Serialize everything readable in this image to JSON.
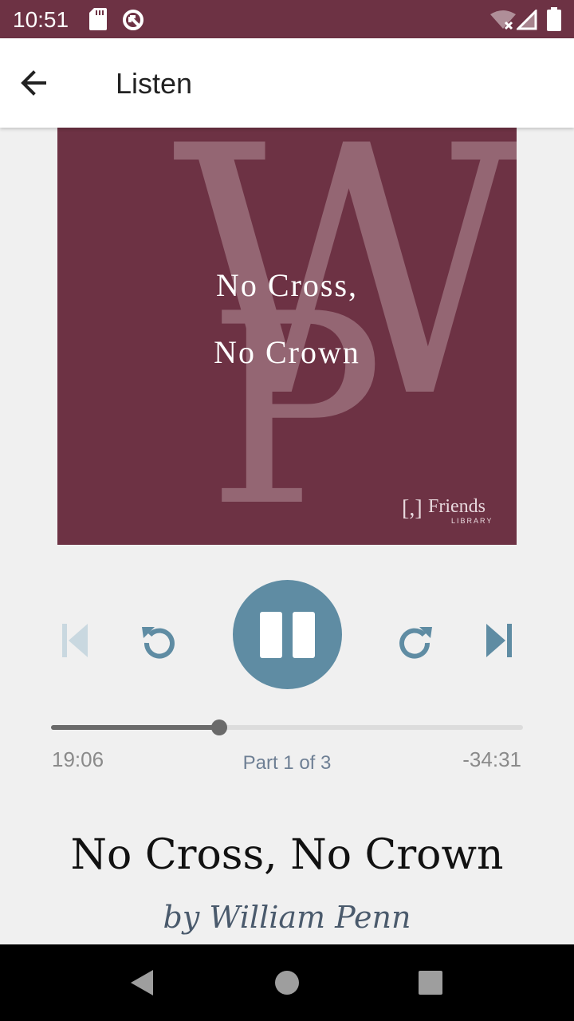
{
  "status_bar": {
    "time": "10:51",
    "background": "#6d3244",
    "left_icons": [
      "sd-card-icon",
      "data-saver-icon"
    ],
    "right_icons": [
      "wifi-off-icon",
      "signal-icon",
      "battery-icon"
    ]
  },
  "app_bar": {
    "back_icon": "arrow-left-icon",
    "title": "Listen"
  },
  "cover": {
    "background": "#6d3244",
    "monogram_top": "W",
    "monogram_bottom": "P",
    "title_line1": "No Cross,",
    "title_line2": "No Crown",
    "publisher_bracket": "[,]",
    "publisher_name": "Friends",
    "publisher_sub": "LIBRARY"
  },
  "controls": {
    "accent": "#5f8ca3",
    "skip_previous_icon": "skip-previous-icon",
    "rewind_icon": "replay-icon",
    "play_pause_icon": "pause-icon",
    "forward_icon": "forward-icon",
    "skip_next_icon": "skip-next-icon"
  },
  "playback": {
    "elapsed": "19:06",
    "remaining": "-34:31",
    "progress_fraction": 0.356,
    "part_label": "Part 1 of 3"
  },
  "book": {
    "title": "No Cross, No Crown",
    "author": "by William Penn"
  },
  "nav_bar": {
    "back_icon": "nav-back-icon",
    "home_icon": "nav-home-icon",
    "recents_icon": "nav-recents-icon"
  }
}
